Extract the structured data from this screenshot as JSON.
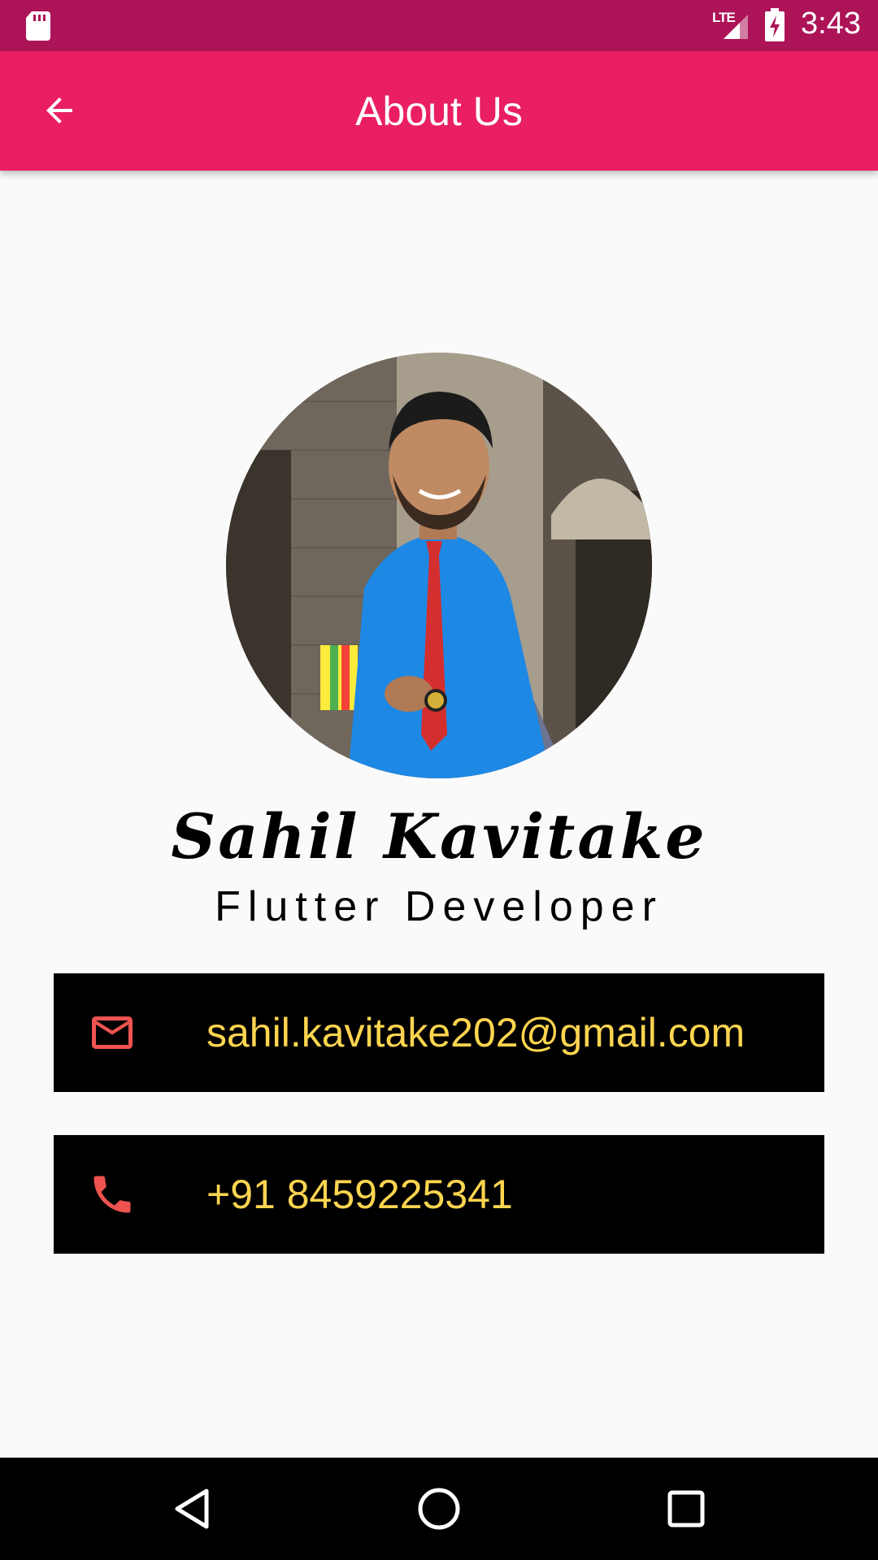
{
  "status_bar": {
    "network": "LTE",
    "time": "3:43",
    "icons": [
      "sd-card-icon",
      "signal-icon",
      "battery-charging-icon"
    ]
  },
  "app_bar": {
    "title": "About Us",
    "back_icon": "arrow-back-icon",
    "color": "#e91e63"
  },
  "profile": {
    "name": "Sahil Kavitake",
    "role": "Flutter Developer"
  },
  "contacts": [
    {
      "icon": "mail-icon",
      "text": "sahil.kavitake202@gmail.com"
    },
    {
      "icon": "phone-icon",
      "text": "+91 8459225341"
    }
  ],
  "colors": {
    "status_bar": "#ad1457",
    "card_background": "#000000",
    "card_text": "#ffd54f",
    "card_icon": "#ef5350"
  },
  "nav_bar": {
    "icons": [
      "nav-back-icon",
      "nav-home-icon",
      "nav-recents-icon"
    ]
  }
}
